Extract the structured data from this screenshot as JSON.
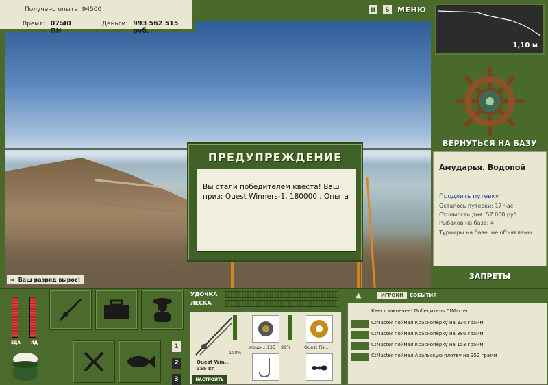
{
  "info": {
    "experience_label": "Получено опыта:",
    "experience_value": "94500",
    "time_label": "Время:",
    "time_value": "07:40 ПН",
    "money_label": "Деньги:",
    "money_value": "993 562 515 руб."
  },
  "header": {
    "pause_icon_label": "II",
    "sound_icon_label": "S",
    "menu_label": "МЕНЮ"
  },
  "scene": {
    "rank_text": "Ваш разряд вырос!"
  },
  "dialog": {
    "title": "ПРЕДУПРЕЖДЕНИЕ",
    "message": "Вы стали победителем квеста! Ваш приз: Quest Winners-1, 180000 , Опыта"
  },
  "depth": {
    "value": "1,10 м"
  },
  "base": {
    "return_label": "ВЕРНУТЬСЯ НА БАЗУ",
    "location_title": "Амударья. Водопой",
    "extend_link": "Продлить путевку",
    "remaining": "Осталось путевки: 17 час.",
    "day_cost": "Стоимость дня: 57 000 руб.",
    "fishers": "Рыбаков на базе: 4",
    "tournaments": "Турниры на базе: не объявлены",
    "bans_label": "ЗАПРЕТЫ"
  },
  "status": {
    "food_label": "ЕДА",
    "poison_label": "ЯД",
    "food_level": 1.0,
    "poison_level": 1.0
  },
  "inventory_pages": [
    "1",
    "2",
    "3"
  ],
  "tackle": {
    "rod_label": "УДОЧКА",
    "line_label": "ЛЕСКА",
    "rod_name": "Quest Win...",
    "rod_weight": "355 кг",
    "rod_percent": "100%",
    "reel_caption": "мощн.: 135",
    "reel_percent": "99%",
    "line_caption": "Quest Fis...",
    "setup_label": "НАСТРОИТЬ"
  },
  "chat": {
    "tab_players": "ИГРОКИ",
    "tab_events": "СОБЫТИЯ",
    "messages": [
      "Квест закончен! Победитель CtMacter",
      "CtMacter поймал Краснопёрку на 334 грамм",
      "CtMacter поймал Краснопёрку на 386 грамм",
      "CtMacter поймал Краснопёрку на 153 грамм",
      "CtMacter поймал Аральскую плотву на 352 грамм"
    ]
  },
  "colors": {
    "panel_green": "#4b6b2c",
    "paper": "#e9e6d2",
    "gauge_red": "#d93d3d"
  }
}
